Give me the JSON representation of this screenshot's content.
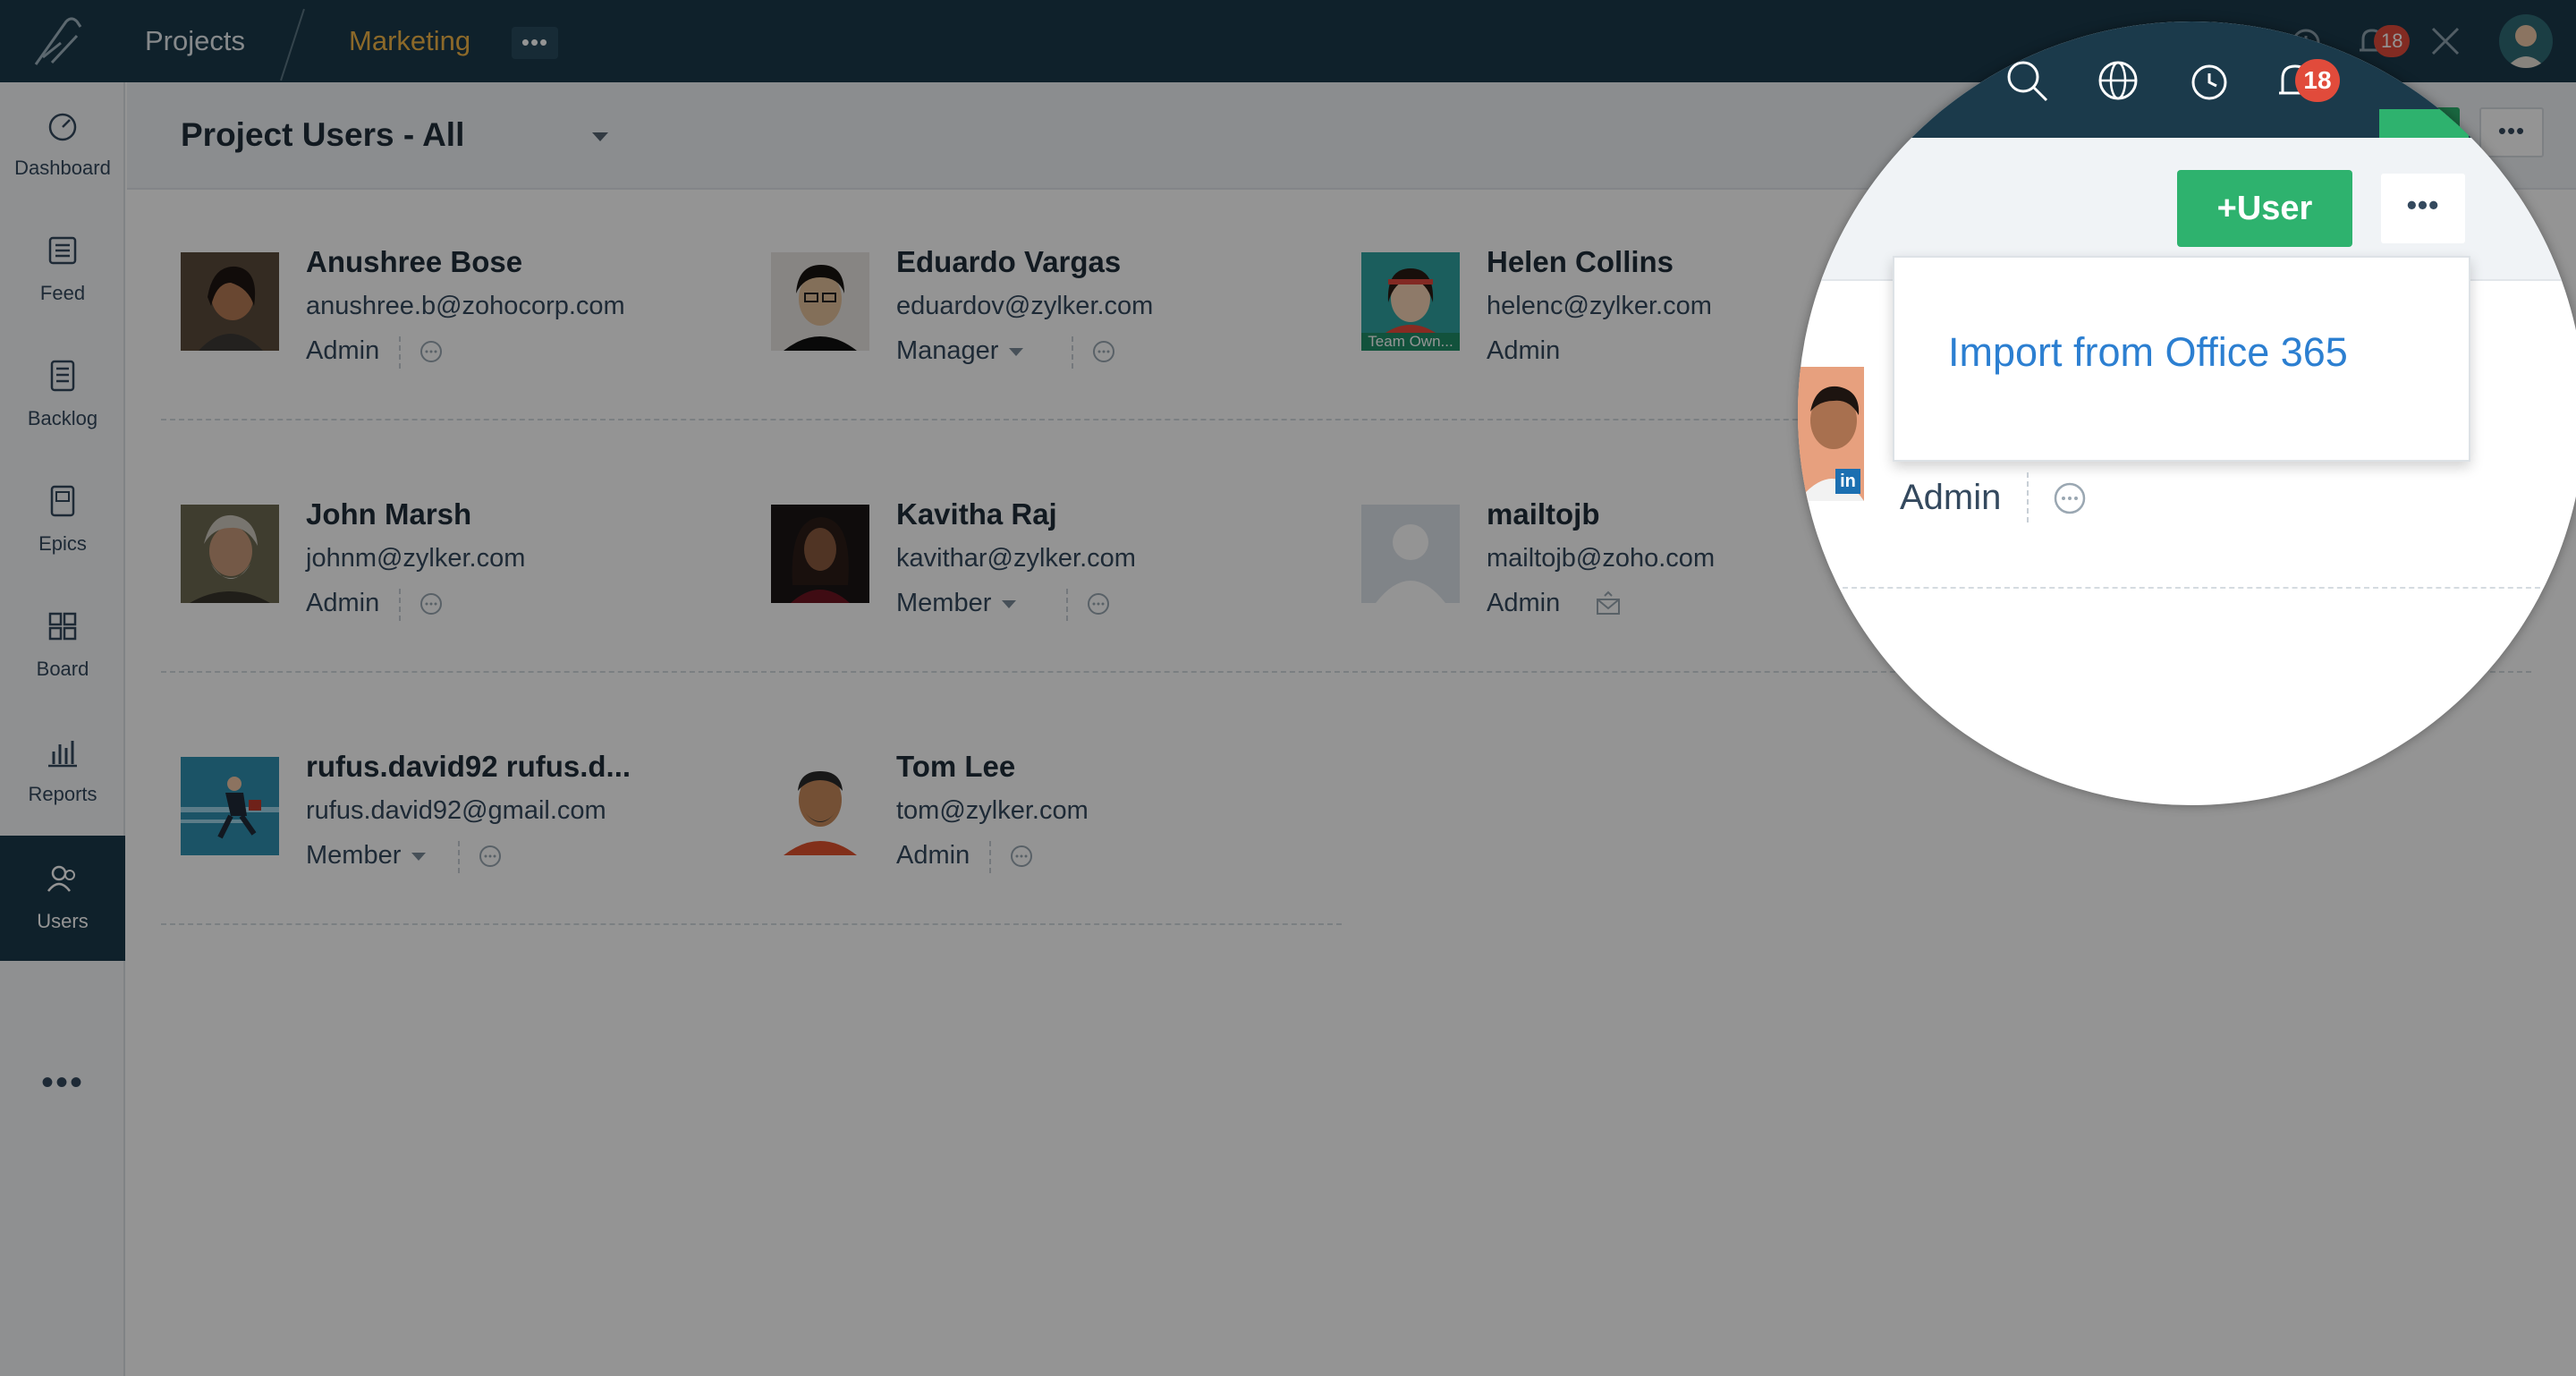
{
  "topbar": {
    "projects_label": "Projects",
    "project_name": "Marketing",
    "more_label": "•••",
    "notification_count": "18"
  },
  "sidebar": {
    "items": [
      {
        "label": "Dashboard",
        "icon": "dashboard-icon"
      },
      {
        "label": "Feed",
        "icon": "feed-icon"
      },
      {
        "label": "Backlog",
        "icon": "backlog-icon"
      },
      {
        "label": "Epics",
        "icon": "epics-icon"
      },
      {
        "label": "Board",
        "icon": "board-icon"
      },
      {
        "label": "Reports",
        "icon": "reports-icon"
      },
      {
        "label": "Users",
        "icon": "users-icon",
        "active": true
      }
    ],
    "more_label": "•••"
  },
  "header": {
    "title": "Project Users - All"
  },
  "users": [
    {
      "name": "Anushree Bose",
      "email": "anushree.b@zohocorp.com",
      "role": "Admin",
      "has_dropdown": false
    },
    {
      "name": "Eduardo Vargas",
      "email": "eduardov@zylker.com",
      "role": "Manager",
      "has_dropdown": true
    },
    {
      "name": "Helen Collins",
      "email": "helenc@zylker.com",
      "role": "Admin",
      "has_dropdown": false,
      "avatar_caption": "Team Own..."
    },
    {
      "name": "John Marsh",
      "email": "johnm@zylker.com",
      "role": "Admin",
      "has_dropdown": false
    },
    {
      "name": "Kavitha Raj",
      "email": "kavithar@zylker.com",
      "role": "Member",
      "has_dropdown": true
    },
    {
      "name": "mailtojb",
      "email": "mailtojb@zoho.com",
      "role": "Admin",
      "has_dropdown": false
    },
    {
      "name": "rufus.david92 rufus.d...",
      "email": "rufus.david92@gmail.com",
      "role": "Member",
      "has_dropdown": true
    },
    {
      "name": "Tom Lee",
      "email": "tom@zylker.com",
      "role": "Admin",
      "has_dropdown": false
    }
  ],
  "magnifier": {
    "notification_count": "18",
    "add_user_label": "+User",
    "more_label": "•••",
    "import_option": "Import from Office 365",
    "linkedin_badge": "in",
    "role": "Admin"
  },
  "colors": {
    "topbar_bg": "#1b3a4b",
    "accent_orange": "#f1b548",
    "primary_green": "#2eb26e",
    "link_blue": "#2c7fd1",
    "badge_red": "#e14b3b"
  }
}
